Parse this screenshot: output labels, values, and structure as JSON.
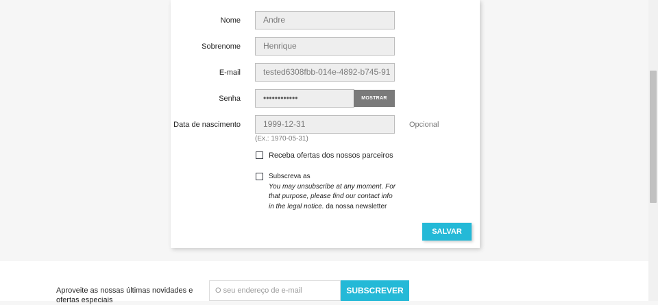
{
  "form": {
    "first_name": {
      "label": "Nome",
      "value": "Andre"
    },
    "last_name": {
      "label": "Sobrenome",
      "value": "Henrique"
    },
    "email": {
      "label": "E-mail",
      "value": "tested6308fbb-014e-4892-b745-91"
    },
    "password": {
      "label": "Senha",
      "value": "••••••••••••",
      "show_label": "MOSTRAR"
    },
    "birthday": {
      "label": "Data de nascimento",
      "value": "1999-12-31",
      "optional": "Opcional",
      "hint": "(Ex.: 1970-05-31)"
    },
    "offers": {
      "label": "Receba ofertas dos nossos parceiros",
      "checked": false
    },
    "newsletter": {
      "label_start": "Subscreva as",
      "label_italic": "You may unsubscribe at any moment. For that purpose, please find our contact info in the legal notice.",
      "label_end": "da nossa newsletter",
      "checked": false
    },
    "save_label": "SALVAR"
  },
  "footer": {
    "text": "Aproveite as nossas últimas novidades e ofertas especiais",
    "email_placeholder": "O seu endereço de e-mail",
    "subscribe_label": "SUBSCREVER"
  },
  "colors": {
    "accent": "#24b9d7",
    "show_button": "#7a7a7a"
  }
}
